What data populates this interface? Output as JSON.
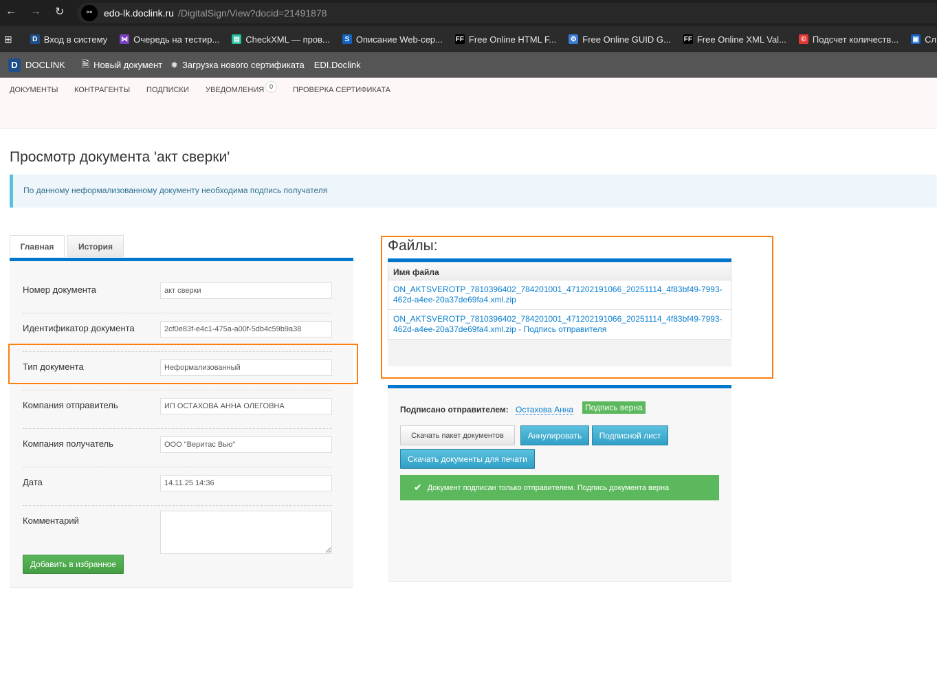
{
  "browser": {
    "url_host": "edo-lk.doclink.ru",
    "url_path": "/DigitalSign/View?docid=21491878",
    "bookmarks": [
      {
        "label": "Вход в систему",
        "icon": "D",
        "color": "#1e4f8a"
      },
      {
        "label": "Очередь на тестир...",
        "icon": "⋈",
        "color": "#7b3fc4"
      },
      {
        "label": "CheckXML — пров...",
        "icon": "▤",
        "color": "#1fbf9f"
      },
      {
        "label": "Описание Web-сер...",
        "icon": "S",
        "color": "#1565c0"
      },
      {
        "label": "Free Online HTML F...",
        "icon": "FF",
        "color": "#000000"
      },
      {
        "label": "Free Online GUID G...",
        "icon": "⚙",
        "color": "#3a7bd5"
      },
      {
        "label": "Free Online XML Val...",
        "icon": "FF",
        "color": "#000000"
      },
      {
        "label": "Подсчет количеств...",
        "icon": "©",
        "color": "#e53935"
      },
      {
        "label": "Слишком длинн",
        "icon": "▣",
        "color": "#1565c0"
      }
    ]
  },
  "appnav": {
    "brand": "DOCLINK",
    "new_doc": "Новый документ",
    "upload_cert": "Загрузка нового сертификата",
    "edi": "EDI.Doclink"
  },
  "mainnav": {
    "items": [
      "ДОКУМЕНТЫ",
      "КОНТРАГЕНТЫ",
      "ПОДПИСКИ",
      "УВЕДОМЛЕНИЯ",
      "ПРОВЕРКА СЕРТИФИКАТА"
    ],
    "notifications_count": "0"
  },
  "page": {
    "title": "Просмотр документа 'акт сверки'",
    "alert": "По данному неформализованному документу необходима подпись получателя"
  },
  "tabs": [
    "Главная",
    "История"
  ],
  "fields": [
    {
      "label": "Номер документа",
      "value": "акт сверки"
    },
    {
      "label": "Идентификатор документа",
      "value": "2cf0e83f-e4c1-475a-a00f-5db4c59b9a38"
    },
    {
      "label": "Тип документа",
      "value": "Неформализованный"
    },
    {
      "label": "Компания отправитель",
      "value": "ИП ОСТАХОВА АННА ОЛЕГОВНА"
    },
    {
      "label": "Компания получатель",
      "value": "ООО \"Веритас Вью\""
    },
    {
      "label": "Дата",
      "value": "14.11.25 14:36"
    },
    {
      "label": "Комментарий",
      "value": ""
    }
  ],
  "favorite_button": "Добавить в избранное",
  "files": {
    "title": "Файлы:",
    "column": "Имя файла",
    "items": [
      "ON_AKTSVEROTP_7810396402_784201001_471202191066_20251114_4f83bf49-7993-462d-a4ee-20a37de69fa4.xml.zip",
      "ON_AKTSVEROTP_7810396402_784201001_471202191066_20251114_4f83bf49-7993-462d-a4ee-20a37de69fa4.xml.zip - Подпись отправителя"
    ]
  },
  "signature": {
    "label": "Подписано отправителем:",
    "signer": "Остахова Анна",
    "badge": "Подпись верна",
    "buttons": [
      "Скачать пакет документов",
      "Аннулировать",
      "Подписной лист",
      "Скачать документы для печати"
    ],
    "status": "Документ подписан только отправителем. Подпись документа верна"
  },
  "colors": {
    "accent": "#0077cc",
    "success": "#5cb85c",
    "highlight": "#ff7f0e",
    "info": "#31a0c6"
  }
}
